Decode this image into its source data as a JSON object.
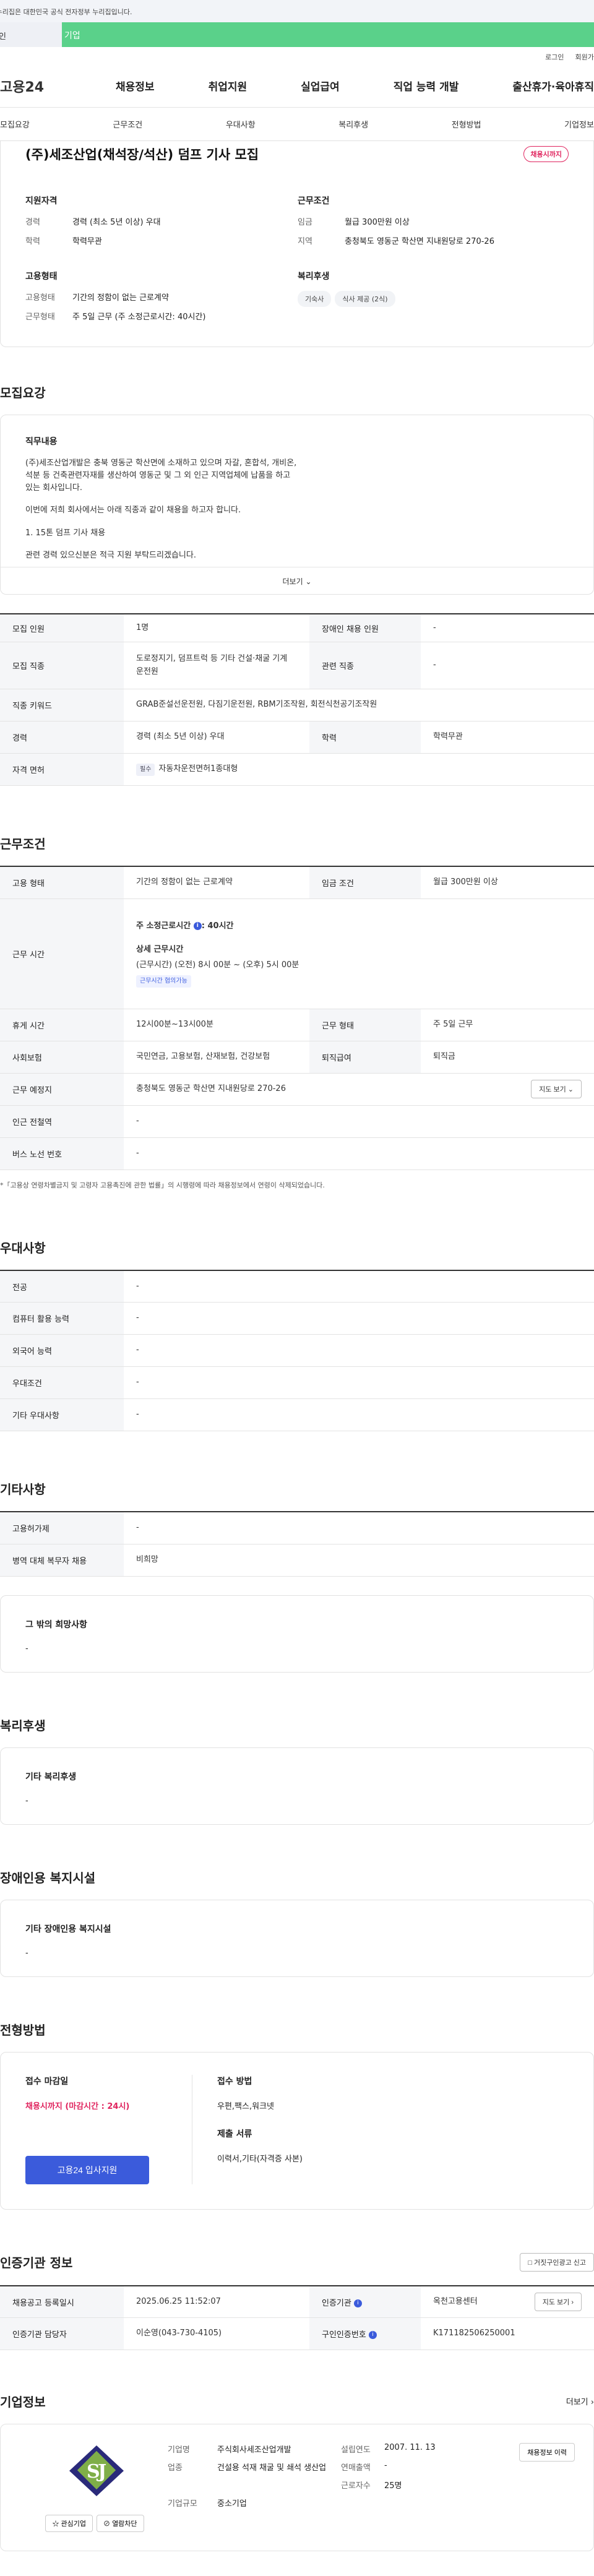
{
  "gov_banner": "이 누리집은 대한민국 공식 전자정부 누리집입니다.",
  "top_tabs": {
    "individual": "개인",
    "corporate": "기업"
  },
  "util": {
    "login": "로그인",
    "join": "회원가입"
  },
  "logo": "고용24",
  "gnb": [
    "채용정보",
    "취업지원",
    "실업급여",
    "직업 능력 개발",
    "출산휴가·육아휴직"
  ],
  "subnav": [
    "모집요강",
    "근무조건",
    "우대사항",
    "복리후생",
    "전형방법",
    "기업정보"
  ],
  "title": "(주)세조산업(채석장/석산) 덤프 기사 모집",
  "status_badge": "채용시까지",
  "summary": {
    "qual": {
      "h": "지원자격",
      "career_k": "경력",
      "career_v": "경력 (최소 5년 이상) 우대",
      "edu_k": "학력",
      "edu_v": "학력무관"
    },
    "cond": {
      "h": "근무조건",
      "wage_k": "임금",
      "wage_v": "월급 300만원 이상",
      "loc_k": "지역",
      "loc_v": "충청북도 영동군 학산면 지내원당로 270-26"
    },
    "emp": {
      "h": "고용형태",
      "type_k": "고용형태",
      "type_v": "기간의 정함이 없는 근로계약",
      "work_k": "근무형태",
      "work_v": "주 5일 근무 (주 소정근로시간: 40시간)"
    },
    "welfare": {
      "h": "복리후생",
      "chips": [
        "기숙사",
        "식사 제공 (2식)"
      ]
    }
  },
  "recruit": {
    "title": "모집요강",
    "desc_h": "직무내용",
    "desc_p1": "(주)세조산업개발은 충북 영동군 학산면에 소재하고 있으며 자갈, 혼합석, 개비온, 석분 등 건축관련자재를 생산하여 영동군 및 그 외 인근 지역업체에 납품을 하고 있는 회사입니다.",
    "desc_p2": "이번에 저희 회사에서는 아래 직종과 같이 채용을 하고자 합니다.",
    "desc_p3": "1. 15톤 덤프 기사 채용",
    "desc_p4": "관련 경력 있으신분은 적극 지원 부탁드리겠습니다.",
    "more": "더보기",
    "rows": {
      "count_k": "모집 인원",
      "count_v": "1명",
      "dis_k": "장애인 채용 인원",
      "dis_v": "-",
      "job_k": "모집 직종",
      "job_v": "도로정지기, 덤프트럭 등 기타 건설·채굴 기계 운전원",
      "rel_k": "관련 직종",
      "rel_v": "-",
      "kw_k": "직종 키워드",
      "kw_v": "GRAB준설선운전원, 다짐기운전원, RBM기조작원, 회전식천공기조작원",
      "car_k": "경력",
      "car_v": "경력 (최소 5년 이상) 우대",
      "edu_k": "학력",
      "edu_v": "학력무관",
      "lic_k": "자격 면허",
      "lic_tag": "필수",
      "lic_v": "자동차운전면허1종대형"
    }
  },
  "work": {
    "title": "근무조건",
    "type_k": "고용 형태",
    "type_v": "기간의 정함이 없는 근로계약",
    "wage_k": "임금 조건",
    "wage_v": "월급 300만원 이상",
    "hours_k": "근무 시간",
    "hours_l1": "주 소정근로시간",
    "hours_l1v": ": 40시간",
    "hours_l2": "상세 근무시간",
    "hours_l3": "(근무시간) (오전) 8시 00분 ~ (오후) 5시 00분",
    "hours_tag": "근무시간 협의가능",
    "break_k": "휴게 시간",
    "break_v": "12시00분~13시00분",
    "form_k": "근무 형태",
    "form_v": "주 5일 근무",
    "ins_k": "사회보험",
    "ins_v": "국민연금, 고용보험, 산재보험, 건강보험",
    "ret_k": "퇴직급여",
    "ret_v": "퇴직금",
    "place_k": "근무 예정지",
    "place_v": "충청북도 영동군 학산면 지내원당로 270-26",
    "map_btn": "지도 보기",
    "sub_k": "인근 전철역",
    "sub_v": "-",
    "bus_k": "버스 노선 번호",
    "bus_v": "-",
    "note": "*「고용상 연령차별금지 및 고령자 고용촉진에 관한 법률」의 시행령에 따라 채용정보에서 연령이 삭제되었습니다."
  },
  "pref": {
    "title": "우대사항",
    "rows": [
      [
        "전공",
        "-"
      ],
      [
        "컴퓨터 활용 능력",
        "-"
      ],
      [
        "외국어 능력",
        "-"
      ],
      [
        "우대조건",
        "-"
      ],
      [
        "기타 우대사항",
        "-"
      ]
    ]
  },
  "etc": {
    "title": "기타사항",
    "emp_k": "고용허가제",
    "emp_v": "-",
    "mil_k": "병역 대체 복무자 채용",
    "mil_v": "비희망",
    "other_h": "그 밖의 희망사항",
    "other_v": "-"
  },
  "welfare": {
    "title": "복리후생",
    "h": "기타 복리후생",
    "v": "-"
  },
  "disab": {
    "title": "장애인용 복지시설",
    "h": "기타 장애인용 복지시설",
    "v": "-"
  },
  "apply": {
    "title": "전형방법",
    "deadline_h": "접수 마감일",
    "deadline_v": "채용시까지 (마감시간 : 24시)",
    "btn": "고용24 입사지원",
    "method_h": "접수 방법",
    "method_v": "우편,팩스,워크넷",
    "docs_h": "제출 서류",
    "docs_v": "이력서,기타(자격증 사본)"
  },
  "cert": {
    "title": "인증기관 정보",
    "report_btn": "거짓구인광고 신고",
    "reg_k": "채용공고 등록일시",
    "reg_v": "2025.06.25 11:52:07",
    "org_k": "인증기관",
    "org_v": "옥천고용센터",
    "map_btn": "지도 보기",
    "mgr_k": "인증기관 담당자",
    "mgr_v": "이순영(043-730-4105)",
    "num_k": "구인인증번호",
    "num_v": "K171182506250001"
  },
  "corp": {
    "title": "기업정보",
    "more": "더보기",
    "logo_letters": "SJ",
    "interest": "관심기업",
    "block": "열람차단",
    "name_k": "기업명",
    "name_v": "주식회사세조산업개발",
    "est_k": "설립연도",
    "est_v": "2007. 11. 13",
    "biz_k": "업종",
    "biz_v": "건설용 석재 채굴 및 쇄석 생산업",
    "sales_k": "연매출액",
    "sales_v": "-",
    "emp_k": "근로자수",
    "emp_v": "25명",
    "size_k": "기업규모",
    "size_v": "중소기업",
    "hist_btn": "채용정보 이력"
  }
}
